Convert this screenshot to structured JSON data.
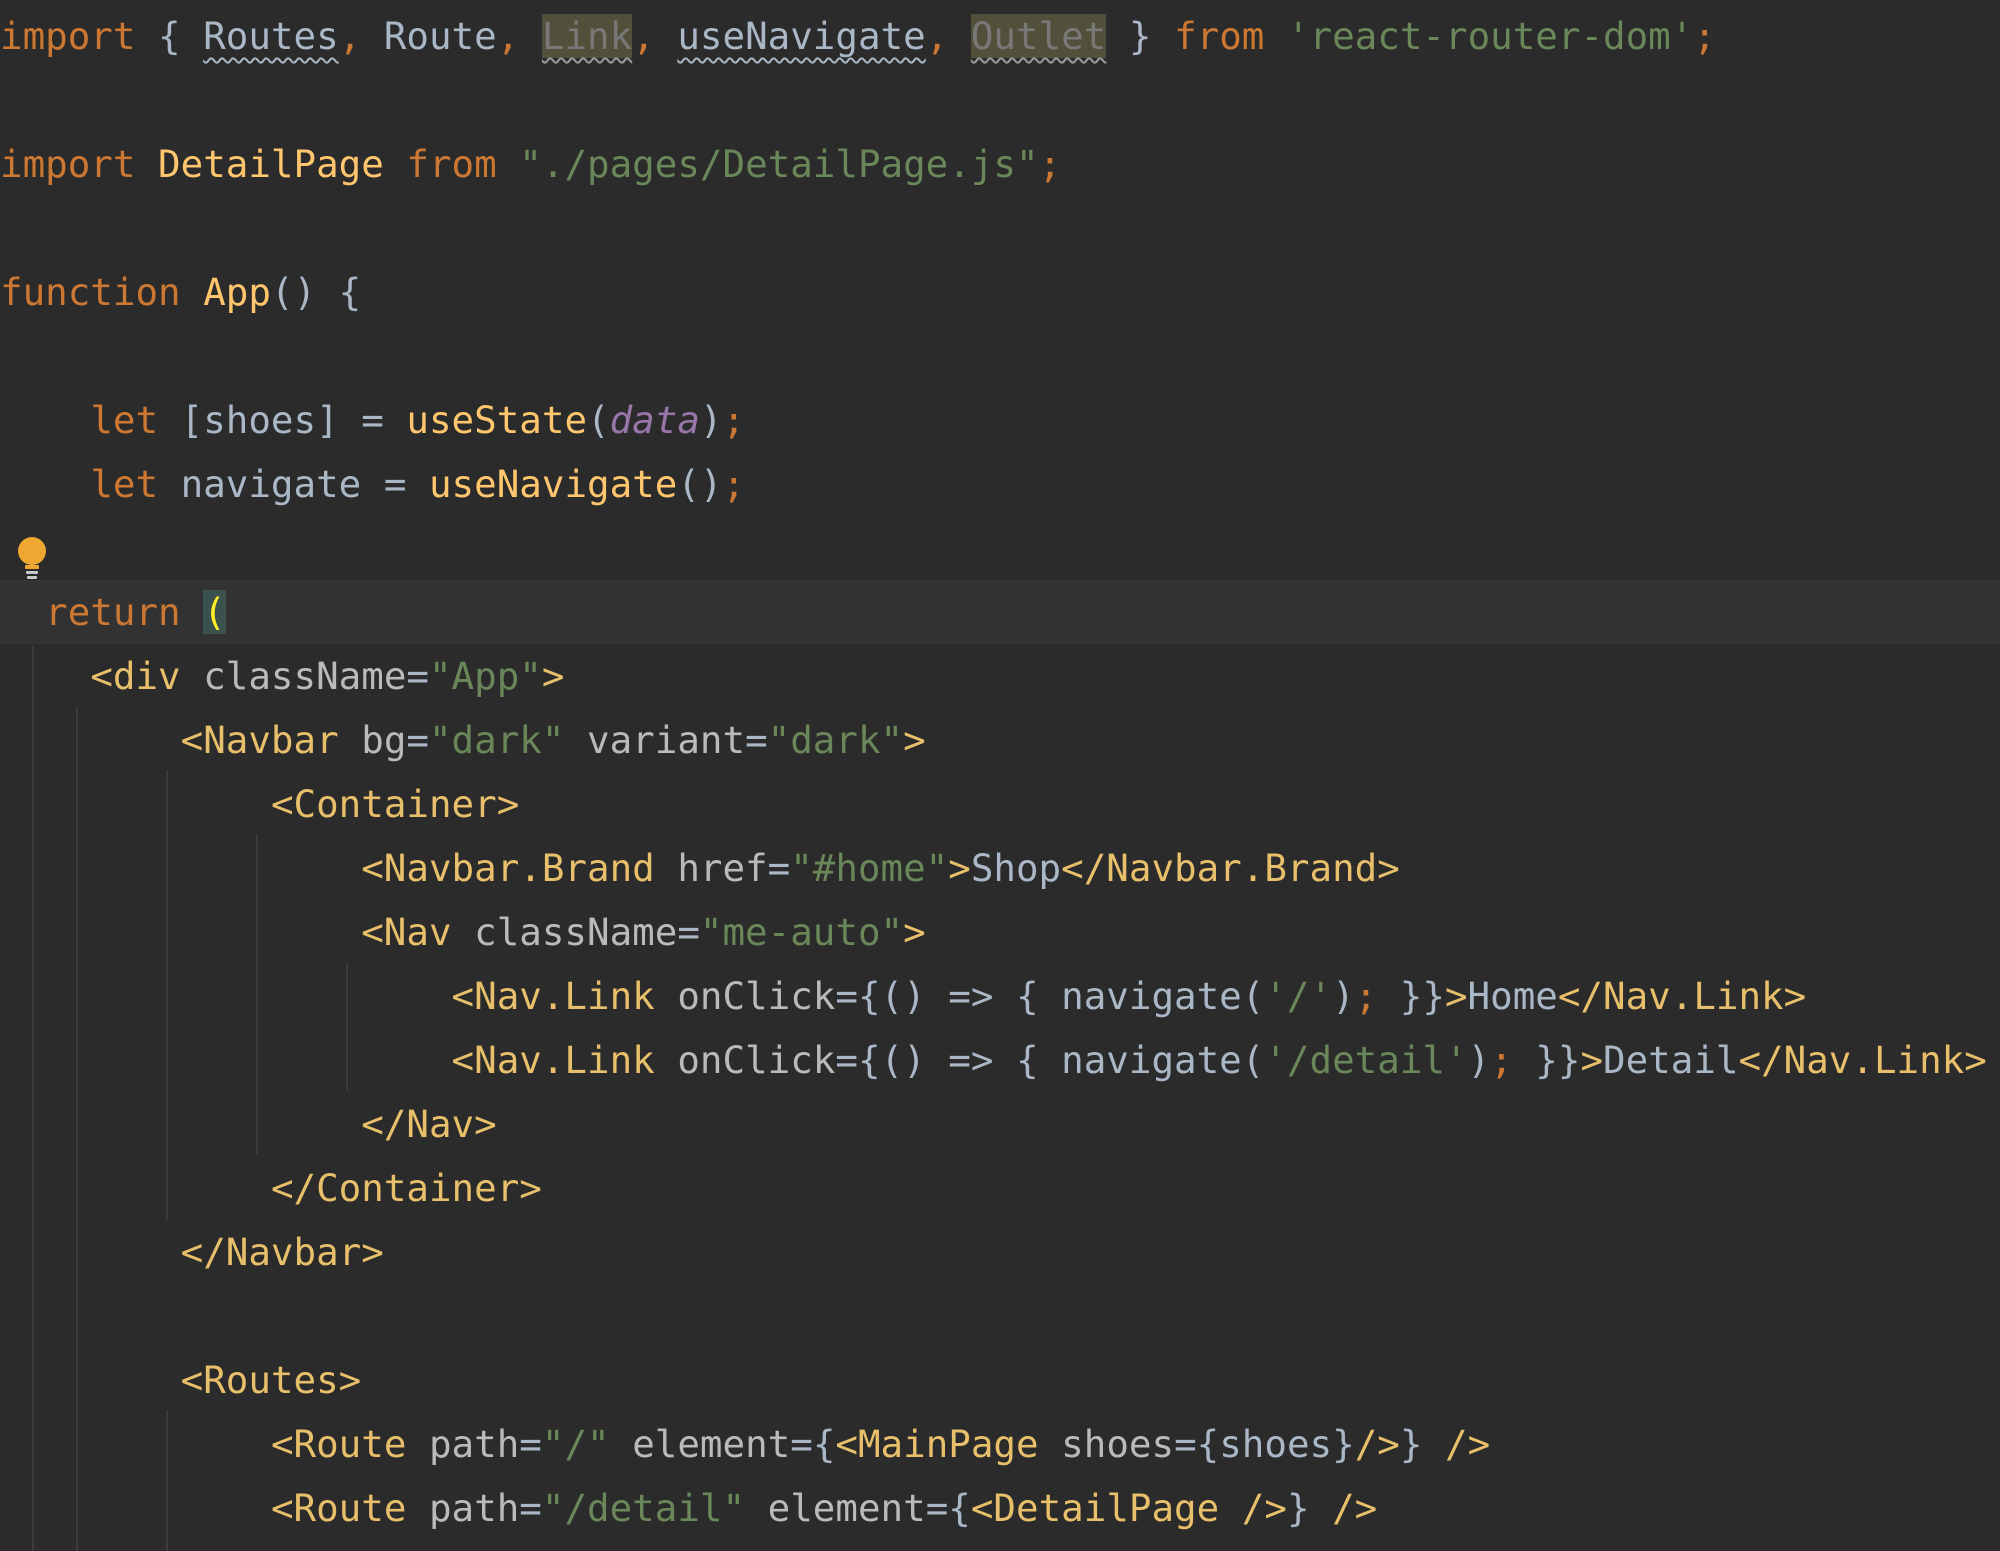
{
  "editor": {
    "lines": [
      {
        "tokens": [
          [
            "import",
            "kw"
          ],
          [
            " { ",
            "plain"
          ],
          [
            "Routes",
            "plain",
            "squig"
          ],
          [
            ", ",
            "kw"
          ],
          [
            "Route",
            "plain"
          ],
          [
            ", ",
            "kw"
          ],
          [
            "Link",
            "unused",
            "squigdim"
          ],
          [
            ", ",
            "kw"
          ],
          [
            "useNavigate",
            "plain",
            "squig"
          ],
          [
            ", ",
            "kw"
          ],
          [
            "Outlet",
            "unused",
            "squigdim"
          ],
          [
            " } ",
            "plain"
          ],
          [
            "from",
            "kw"
          ],
          [
            " ",
            "plain"
          ],
          [
            "'react-router-dom'",
            "str"
          ],
          [
            ";",
            "kw"
          ]
        ]
      },
      {
        "tokens": []
      },
      {
        "tokens": [
          [
            "import",
            "kw"
          ],
          [
            " ",
            "plain"
          ],
          [
            "DetailPage",
            "fn"
          ],
          [
            " ",
            "plain"
          ],
          [
            "from",
            "kw"
          ],
          [
            " ",
            "plain"
          ],
          [
            "\"./pages/DetailPage.js\"",
            "str"
          ],
          [
            ";",
            "kw"
          ]
        ]
      },
      {
        "tokens": []
      },
      {
        "tokens": [
          [
            "function",
            "kw"
          ],
          [
            " ",
            "plain"
          ],
          [
            "App",
            "fn"
          ],
          [
            "() {",
            "plain"
          ]
        ]
      },
      {
        "tokens": []
      },
      {
        "tokens": [
          [
            "    ",
            "plain"
          ],
          [
            "let",
            "kw"
          ],
          [
            " [shoes] = ",
            "plain"
          ],
          [
            "useState",
            "fn"
          ],
          [
            "(",
            "plain"
          ],
          [
            "data",
            "const"
          ],
          [
            ")",
            "plain"
          ],
          [
            ";",
            "kw"
          ]
        ]
      },
      {
        "tokens": [
          [
            "    ",
            "plain"
          ],
          [
            "let",
            "kw"
          ],
          [
            " navigate = ",
            "plain"
          ],
          [
            "useNavigate",
            "fn"
          ],
          [
            "()",
            "plain"
          ],
          [
            ";",
            "kw"
          ]
        ]
      },
      {
        "tokens": []
      },
      {
        "tokens": [
          [
            "  ",
            "plain"
          ],
          [
            "return",
            "kw"
          ],
          [
            " ",
            "plain"
          ],
          [
            "(",
            "paren"
          ]
        ]
      },
      {
        "tokens": [
          [
            "    ",
            "plain"
          ],
          [
            "<div",
            "tag"
          ],
          [
            " ",
            "plain"
          ],
          [
            "className",
            "attr"
          ],
          [
            "=",
            "plain"
          ],
          [
            "\"App\"",
            "str"
          ],
          [
            ">",
            "tag"
          ]
        ]
      },
      {
        "tokens": [
          [
            "        ",
            "plain"
          ],
          [
            "<Navbar",
            "tag"
          ],
          [
            " ",
            "plain"
          ],
          [
            "bg",
            "attr"
          ],
          [
            "=",
            "plain"
          ],
          [
            "\"dark\"",
            "str"
          ],
          [
            " ",
            "plain"
          ],
          [
            "variant",
            "attr"
          ],
          [
            "=",
            "plain"
          ],
          [
            "\"dark\"",
            "str"
          ],
          [
            ">",
            "tag"
          ]
        ]
      },
      {
        "tokens": [
          [
            "            ",
            "plain"
          ],
          [
            "<Container>",
            "tag"
          ]
        ]
      },
      {
        "tokens": [
          [
            "                ",
            "plain"
          ],
          [
            "<Navbar.Brand",
            "tag"
          ],
          [
            " ",
            "plain"
          ],
          [
            "href",
            "attr"
          ],
          [
            "=",
            "plain"
          ],
          [
            "\"#home\"",
            "str"
          ],
          [
            ">",
            "tag"
          ],
          [
            "Shop",
            "plain"
          ],
          [
            "</Navbar.Brand>",
            "tag"
          ]
        ]
      },
      {
        "tokens": [
          [
            "                ",
            "plain"
          ],
          [
            "<Nav",
            "tag"
          ],
          [
            " ",
            "plain"
          ],
          [
            "className",
            "attr"
          ],
          [
            "=",
            "plain"
          ],
          [
            "\"me-auto\"",
            "str"
          ],
          [
            ">",
            "tag"
          ]
        ]
      },
      {
        "tokens": [
          [
            "                    ",
            "plain"
          ],
          [
            "<Nav.Link",
            "tag"
          ],
          [
            " ",
            "plain"
          ],
          [
            "onClick",
            "attr"
          ],
          [
            "={",
            "plain"
          ],
          [
            "() => { navigate(",
            "plain"
          ],
          [
            "'/'",
            "str"
          ],
          [
            ")",
            "plain"
          ],
          [
            ";",
            "kw"
          ],
          [
            " }}",
            "plain"
          ],
          [
            ">",
            "tag"
          ],
          [
            "Home",
            "plain"
          ],
          [
            "</Nav.Link>",
            "tag"
          ]
        ]
      },
      {
        "tokens": [
          [
            "                    ",
            "plain"
          ],
          [
            "<Nav.Link",
            "tag"
          ],
          [
            " ",
            "plain"
          ],
          [
            "onClick",
            "attr"
          ],
          [
            "={",
            "plain"
          ],
          [
            "() => { navigate(",
            "plain"
          ],
          [
            "'/detail'",
            "str"
          ],
          [
            ")",
            "plain"
          ],
          [
            ";",
            "kw"
          ],
          [
            " }}",
            "plain"
          ],
          [
            ">",
            "tag"
          ],
          [
            "Detail",
            "plain"
          ],
          [
            "</Nav.Link>",
            "tag"
          ]
        ]
      },
      {
        "tokens": [
          [
            "                ",
            "plain"
          ],
          [
            "</Nav>",
            "tag"
          ]
        ]
      },
      {
        "tokens": [
          [
            "            ",
            "plain"
          ],
          [
            "</Container>",
            "tag"
          ]
        ]
      },
      {
        "tokens": [
          [
            "        ",
            "plain"
          ],
          [
            "</Navbar>",
            "tag"
          ]
        ]
      },
      {
        "tokens": []
      },
      {
        "tokens": [
          [
            "        ",
            "plain"
          ],
          [
            "<Routes>",
            "tag"
          ]
        ]
      },
      {
        "tokens": [
          [
            "            ",
            "plain"
          ],
          [
            "<Route",
            "tag"
          ],
          [
            " ",
            "plain"
          ],
          [
            "path",
            "attr"
          ],
          [
            "=",
            "plain"
          ],
          [
            "\"/\"",
            "str"
          ],
          [
            " ",
            "plain"
          ],
          [
            "element",
            "attr"
          ],
          [
            "=",
            "plain"
          ],
          [
            "{",
            "plain"
          ],
          [
            "<MainPage",
            "tag"
          ],
          [
            " ",
            "plain"
          ],
          [
            "shoes",
            "attr"
          ],
          [
            "=",
            "plain"
          ],
          [
            "{shoes}",
            "plain"
          ],
          [
            "/>",
            "tag"
          ],
          [
            "} ",
            "plain"
          ],
          [
            "/>",
            "tag"
          ]
        ]
      },
      {
        "tokens": [
          [
            "            ",
            "plain"
          ],
          [
            "<Route",
            "tag"
          ],
          [
            " ",
            "plain"
          ],
          [
            "path",
            "attr"
          ],
          [
            "=",
            "plain"
          ],
          [
            "\"/detail\"",
            "str"
          ],
          [
            " ",
            "plain"
          ],
          [
            "element",
            "attr"
          ],
          [
            "=",
            "plain"
          ],
          [
            "{",
            "plain"
          ],
          [
            "<DetailPage",
            "tag"
          ],
          [
            " ",
            "plain"
          ],
          [
            "/>",
            "tag"
          ],
          [
            "} ",
            "plain"
          ],
          [
            "/>",
            "tag"
          ]
        ]
      }
    ]
  },
  "gutter": {
    "bulb_icon": "lightbulb-icon"
  },
  "colors": {
    "background": "#2b2b2b",
    "caret_row": "#323232",
    "keyword": "#cc7832",
    "string": "#6a8759",
    "tag": "#e8bf6a",
    "function": "#ffc66d",
    "constant": "#9876aa",
    "text": "#a9b7c6"
  }
}
